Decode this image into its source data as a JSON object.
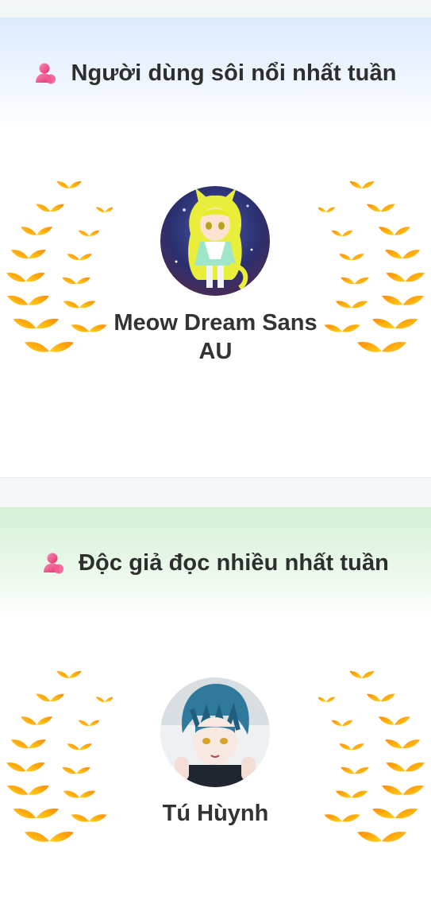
{
  "sections": [
    {
      "title": "Người dùng sôi nổi nhất tuần",
      "icon": "user-icon",
      "user_name": "Meow Dream Sans AU",
      "avatar": "avatar-cat-girl",
      "header_color": "#dbeafd"
    },
    {
      "title": "Độc giả đọc nhiều nhất tuần",
      "icon": "user-icon",
      "user_name": "Tú Hùynh",
      "avatar": "avatar-blue-hair-boy",
      "header_color": "#d3f0d4"
    }
  ],
  "colors": {
    "wreath_light": "#ffd21f",
    "wreath_dark": "#ff8a00",
    "icon_pink": "#e8407f"
  }
}
